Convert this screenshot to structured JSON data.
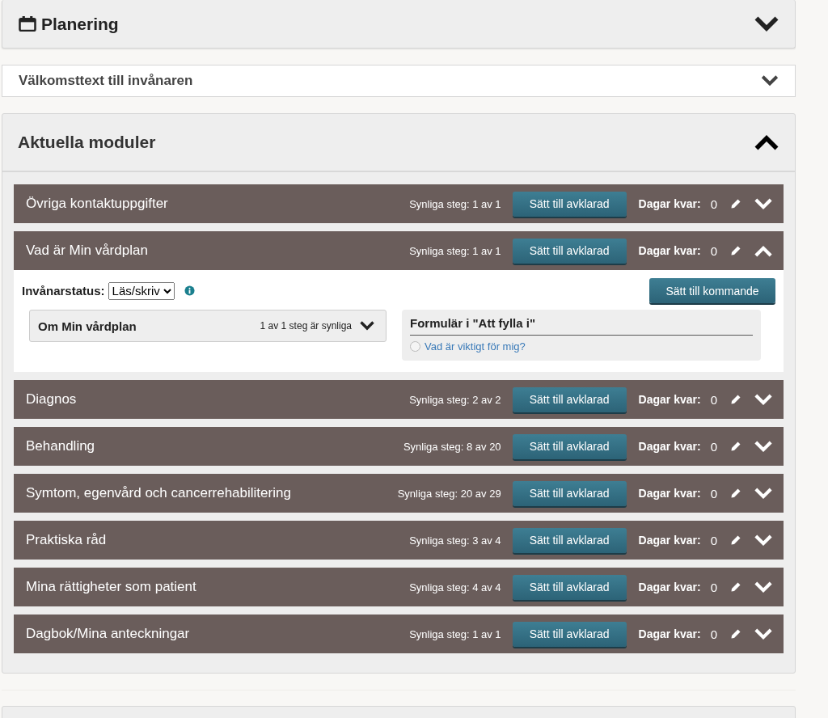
{
  "planning": {
    "title": "Planering",
    "expanded": false
  },
  "welcome": {
    "title": "Välkomsttext till invånaren",
    "expanded": false
  },
  "modules_panel": {
    "title": "Aktuella moduler",
    "expanded": true
  },
  "modules": [
    {
      "title": "Övriga kontaktuppgifter",
      "steps": "Synliga steg: 1 av 1",
      "button": "Sätt till avklarad",
      "days_label": "Dagar kvar:",
      "days": "0",
      "expanded": false
    },
    {
      "title": "Vad är Min vårdplan",
      "steps": "Synliga steg: 1 av 1",
      "button": "Sätt till avklarad",
      "days_label": "Dagar kvar:",
      "days": "0",
      "expanded": true,
      "detail": {
        "status_label": "Invånarstatus:",
        "status_value": "Läs/skriv",
        "upcoming_button": "Sätt till kommande",
        "submodule": {
          "title": "Om Min vårdplan",
          "steps": "1 av 1 steg är synliga",
          "expanded": false
        },
        "form": {
          "title": "Formulär i \"Att fylla i\"",
          "items": [
            {
              "label": "Vad är viktigt för mig?",
              "checked": false
            }
          ]
        }
      }
    },
    {
      "title": "Diagnos",
      "steps": "Synliga steg: 2 av 2",
      "button": "Sätt till avklarad",
      "days_label": "Dagar kvar:",
      "days": "0",
      "expanded": false
    },
    {
      "title": "Behandling",
      "steps": "Synliga steg: 8 av 20",
      "button": "Sätt till avklarad",
      "days_label": "Dagar kvar:",
      "days": "0",
      "expanded": false
    },
    {
      "title": "Symtom, egenvård och cancerrehabilitering",
      "steps": "Synliga steg: 20 av 29",
      "button": "Sätt till avklarad",
      "days_label": "Dagar kvar:",
      "days": "0",
      "expanded": false
    },
    {
      "title": "Praktiska råd",
      "steps": "Synliga steg: 3 av 4",
      "button": "Sätt till avklarad",
      "days_label": "Dagar kvar:",
      "days": "0",
      "expanded": false
    },
    {
      "title": "Mina rättigheter som patient",
      "steps": "Synliga steg: 4 av 4",
      "button": "Sätt till avklarad",
      "days_label": "Dagar kvar:",
      "days": "0",
      "expanded": false
    },
    {
      "title": "Dagbok/Mina anteckningar",
      "steps": "Synliga steg: 1 av 1",
      "button": "Sätt till avklarad",
      "days_label": "Dagar kvar:",
      "days": "0",
      "expanded": false
    }
  ]
}
